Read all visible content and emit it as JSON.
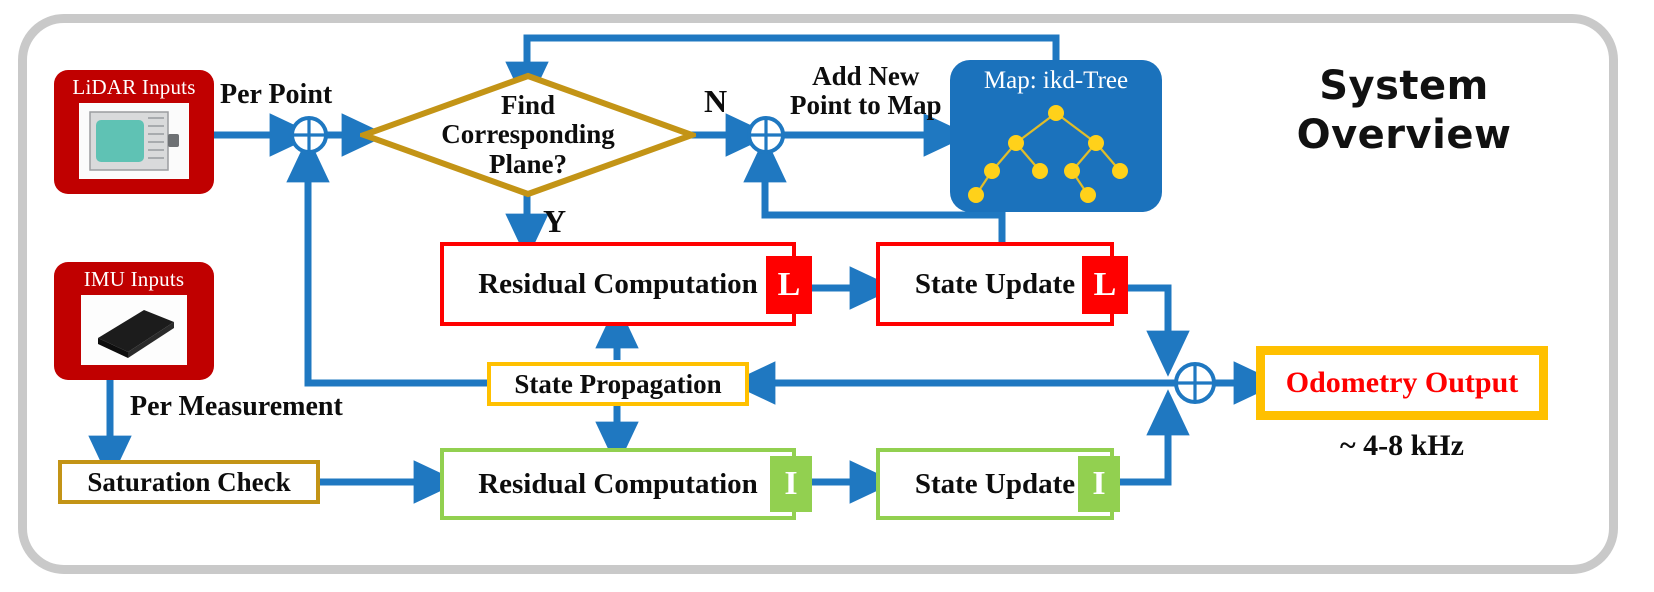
{
  "title": {
    "line1": "System",
    "line2": "Overview"
  },
  "colors": {
    "arrow_blue": "#1f78c1",
    "source_red": "#c00000",
    "diamond_gold": "#c39416",
    "map_blue": "#1b72bc",
    "tree_yellow": "#ffd11a",
    "box_red": "#ff0000",
    "box_green": "#92d050",
    "box_yellow": "#ffc000",
    "frame_gray": "#c9c9c9",
    "odometry_text_red": "#ff0000"
  },
  "nodes": {
    "lidar_inputs": {
      "label": "LiDAR Inputs",
      "icon": "lidar-device-image"
    },
    "imu_inputs": {
      "label": "IMU Inputs",
      "icon": "imu-device-image"
    },
    "find_plane": {
      "line1": "Find",
      "line2": "Corresponding",
      "line3": "Plane?"
    },
    "map": {
      "label": "Map: ikd-Tree",
      "icon": "kd-tree-graph"
    },
    "residual_lidar": {
      "label": "Residual Computation",
      "badge": "L"
    },
    "state_update_lidar": {
      "label": "State Update",
      "badge": "L"
    },
    "state_propagation": {
      "label": "State Propagation"
    },
    "saturation_check": {
      "label": "Saturation Check"
    },
    "residual_imu": {
      "label": "Residual Computation",
      "badge": "I"
    },
    "state_update_imu": {
      "label": "State Update",
      "badge": "I"
    },
    "odometry_output": {
      "label": "Odometry Output",
      "rate": "~ 4-8 kHz"
    }
  },
  "edge_labels": {
    "per_point": "Per Point",
    "per_measurement": "Per Measurement",
    "decision_no": "N",
    "decision_yes": "Y",
    "add_new_point": "Add New\nPoint to Map"
  },
  "junctions": {
    "lidar_sum": "⊕",
    "map_sum": "⊕",
    "output_sum": "⊕"
  },
  "chart_data": {
    "type": "diagram",
    "title": "System Overview",
    "nodes": [
      {
        "id": "lidar_inputs",
        "label": "LiDAR Inputs",
        "shape": "rounded-rect",
        "fill": "#c00000"
      },
      {
        "id": "imu_inputs",
        "label": "IMU Inputs",
        "shape": "rounded-rect",
        "fill": "#c00000"
      },
      {
        "id": "lidar_sum",
        "label": "⊕",
        "shape": "circle-plus"
      },
      {
        "id": "find_plane",
        "label": "Find Corresponding Plane?",
        "shape": "diamond",
        "stroke": "#c39416"
      },
      {
        "id": "map_sum",
        "label": "⊕",
        "shape": "circle-plus"
      },
      {
        "id": "map",
        "label": "Map: ikd-Tree",
        "shape": "rounded-rect",
        "fill": "#1b72bc"
      },
      {
        "id": "residual_lidar",
        "label": "Residual Computation L",
        "shape": "rect",
        "stroke": "#ff0000"
      },
      {
        "id": "state_update_lidar",
        "label": "State Update L",
        "shape": "rect",
        "stroke": "#ff0000"
      },
      {
        "id": "state_propagation",
        "label": "State Propagation",
        "shape": "rect",
        "stroke": "#ffc000"
      },
      {
        "id": "saturation_check",
        "label": "Saturation Check",
        "shape": "rect",
        "stroke": "#c39416"
      },
      {
        "id": "residual_imu",
        "label": "Residual Computation I",
        "shape": "rect",
        "stroke": "#92d050"
      },
      {
        "id": "state_update_imu",
        "label": "State Update I",
        "shape": "rect",
        "stroke": "#92d050"
      },
      {
        "id": "output_sum",
        "label": "⊕",
        "shape": "circle-plus"
      },
      {
        "id": "odometry_output",
        "label": "Odometry Output",
        "shape": "rect",
        "stroke": "#ffc000"
      }
    ],
    "edges": [
      {
        "from": "lidar_inputs",
        "to": "lidar_sum",
        "label": "Per Point"
      },
      {
        "from": "lidar_sum",
        "to": "find_plane",
        "label": ""
      },
      {
        "from": "find_plane",
        "to": "map_sum",
        "label": "N"
      },
      {
        "from": "find_plane",
        "to": "residual_lidar",
        "label": "Y"
      },
      {
        "from": "map_sum",
        "to": "map",
        "label": "Add New Point to Map"
      },
      {
        "from": "map",
        "to": "find_plane",
        "label": ""
      },
      {
        "from": "residual_lidar",
        "to": "state_update_lidar",
        "label": ""
      },
      {
        "from": "state_update_lidar",
        "to": "map_sum",
        "label": ""
      },
      {
        "from": "state_update_lidar",
        "to": "output_sum",
        "label": ""
      },
      {
        "from": "state_propagation",
        "to": "lidar_sum",
        "label": ""
      },
      {
        "from": "state_propagation",
        "to": "residual_lidar",
        "label": ""
      },
      {
        "from": "state_propagation",
        "to": "residual_imu",
        "label": ""
      },
      {
        "from": "output_sum",
        "to": "state_propagation",
        "label": ""
      },
      {
        "from": "imu_inputs",
        "to": "saturation_check",
        "label": "Per Measurement"
      },
      {
        "from": "saturation_check",
        "to": "residual_imu",
        "label": ""
      },
      {
        "from": "residual_imu",
        "to": "state_update_imu",
        "label": ""
      },
      {
        "from": "state_update_imu",
        "to": "output_sum",
        "label": ""
      },
      {
        "from": "output_sum",
        "to": "odometry_output",
        "label": ""
      }
    ],
    "annotations": [
      "~ 4-8 kHz"
    ]
  }
}
